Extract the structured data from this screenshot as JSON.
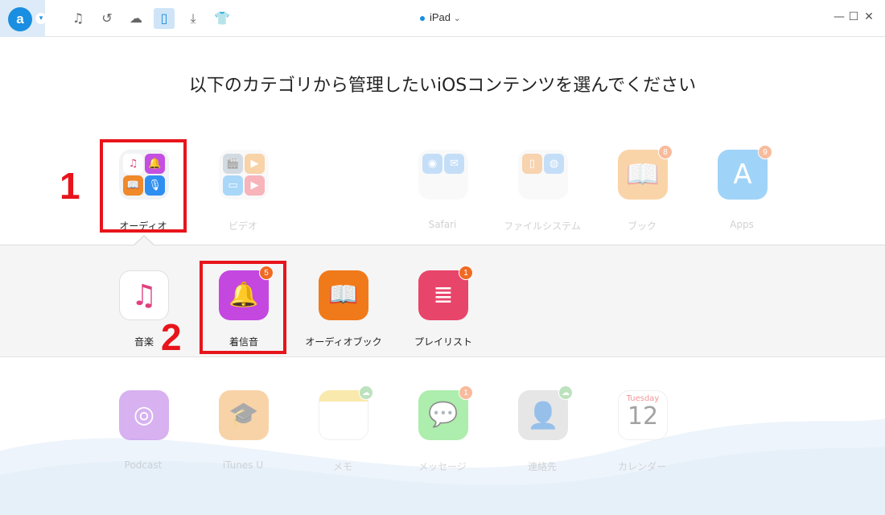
{
  "titlebar": {
    "logo_letter": "a",
    "device_name": "iPad",
    "device_arrow": "⌄"
  },
  "page": {
    "title": "以下のカテゴリから管理したいiOSコンテンツを選んでください"
  },
  "categories": [
    {
      "label": "オーディオ",
      "icon": "audio-grid-icon",
      "selected": true
    },
    {
      "label": "ビデオ",
      "icon": "video-grid-icon"
    },
    {
      "label": "Safari",
      "icon": "safari-icon"
    },
    {
      "label": "ファイルシステム",
      "icon": "file-system-icon"
    },
    {
      "label": "ブック",
      "icon": "books-icon",
      "badge": "8"
    },
    {
      "label": "Apps",
      "icon": "app-store-icon",
      "badge": "9"
    }
  ],
  "audio_sub": [
    {
      "label": "音楽",
      "icon": "music-note-icon"
    },
    {
      "label": "着信音",
      "icon": "bell-icon",
      "badge": "5"
    },
    {
      "label": "オーディオブック",
      "icon": "audiobook-icon"
    },
    {
      "label": "プレイリスト",
      "icon": "playlist-icon",
      "badge": "1"
    }
  ],
  "lower": [
    {
      "label": "Podcast",
      "icon": "podcast-icon"
    },
    {
      "label": "iTunes U",
      "icon": "itunes-u-icon"
    },
    {
      "label": "メモ",
      "icon": "notes-icon"
    },
    {
      "label": "メッセージ",
      "icon": "messages-icon",
      "badge": "1"
    },
    {
      "label": "連絡先",
      "icon": "contacts-icon"
    },
    {
      "label": "カレンダー",
      "icon": "calendar-icon",
      "day": "Tuesday",
      "date": "12"
    }
  ],
  "annotations": {
    "one": "1",
    "two": "2"
  },
  "colors": {
    "accent": "#1a8ee0",
    "annotation": "#e8141b",
    "badge": "#f06a23"
  }
}
